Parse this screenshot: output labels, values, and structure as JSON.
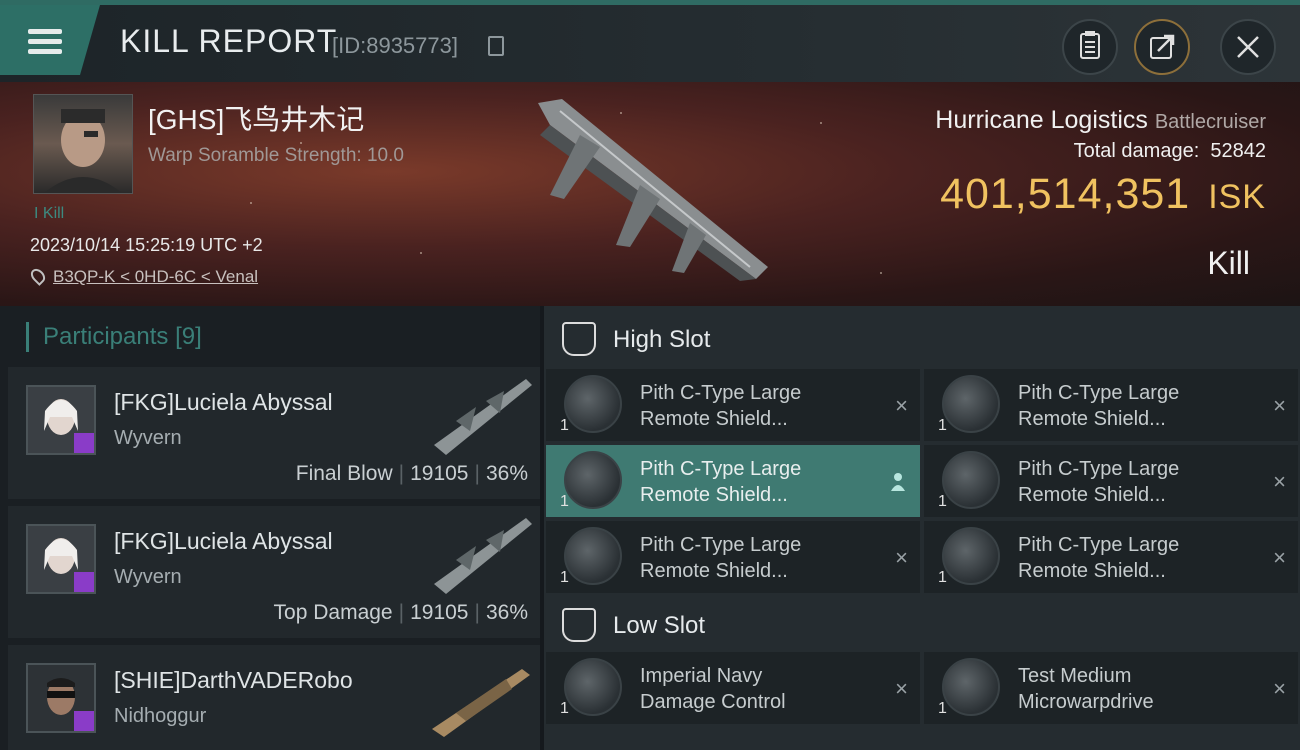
{
  "header": {
    "title": "KILL REPORT",
    "report_id": "[ID:8935773]"
  },
  "victim": {
    "name": "[GHS]飞鸟井木记",
    "scramble": "Warp Soramble Strength: 10.0",
    "kills": "I Kill",
    "time": "2023/10/14 15:25:19 UTC +2",
    "location": "B3QP-K < 0HD-6C < Venal"
  },
  "ship": {
    "name": "Hurricane Logistics",
    "class": "Battlecruiser",
    "total_damage_label": "Total damage:",
    "total_damage": "52842",
    "value": "401,514,351",
    "value_unit": "ISK",
    "result": "Kill"
  },
  "participants": {
    "label": "Participants",
    "count": "[9]",
    "items": [
      {
        "name": "[FKG]Luciela Abyssal",
        "ship": "Wyvern",
        "tag": "Final Blow",
        "damage": "19105",
        "percent": "36%"
      },
      {
        "name": "[FKG]Luciela Abyssal",
        "ship": "Wyvern",
        "tag": "Top Damage",
        "damage": "19105",
        "percent": "36%"
      },
      {
        "name": "[SHIE]DarthVADERobo",
        "ship": "Nidhoggur",
        "tag": "",
        "damage": "",
        "percent": ""
      }
    ]
  },
  "slots": {
    "high": {
      "label": "High Slot",
      "modules": [
        {
          "qty": "1",
          "name1": "Pith C-Type Large",
          "name2": "Remote Shield..."
        },
        {
          "qty": "1",
          "name1": "Pith C-Type Large",
          "name2": "Remote Shield..."
        },
        {
          "qty": "1",
          "name1": "Pith C-Type Large",
          "name2": "Remote Shield..."
        },
        {
          "qty": "1",
          "name1": "Pith C-Type Large",
          "name2": "Remote Shield..."
        },
        {
          "qty": "1",
          "name1": "Pith C-Type Large",
          "name2": "Remote Shield..."
        },
        {
          "qty": "1",
          "name1": "Pith C-Type Large",
          "name2": "Remote Shield..."
        }
      ]
    },
    "low": {
      "label": "Low Slot",
      "modules": [
        {
          "qty": "1",
          "name1": "Imperial Navy",
          "name2": "Damage Control"
        },
        {
          "qty": "1",
          "name1": "Test Medium",
          "name2": "Microwarpdrive"
        }
      ]
    }
  },
  "icons": {
    "close": "×"
  },
  "colors": {
    "accent": "#3f7a72",
    "isk": "#f0c260",
    "badge": "#8a3cc8"
  }
}
